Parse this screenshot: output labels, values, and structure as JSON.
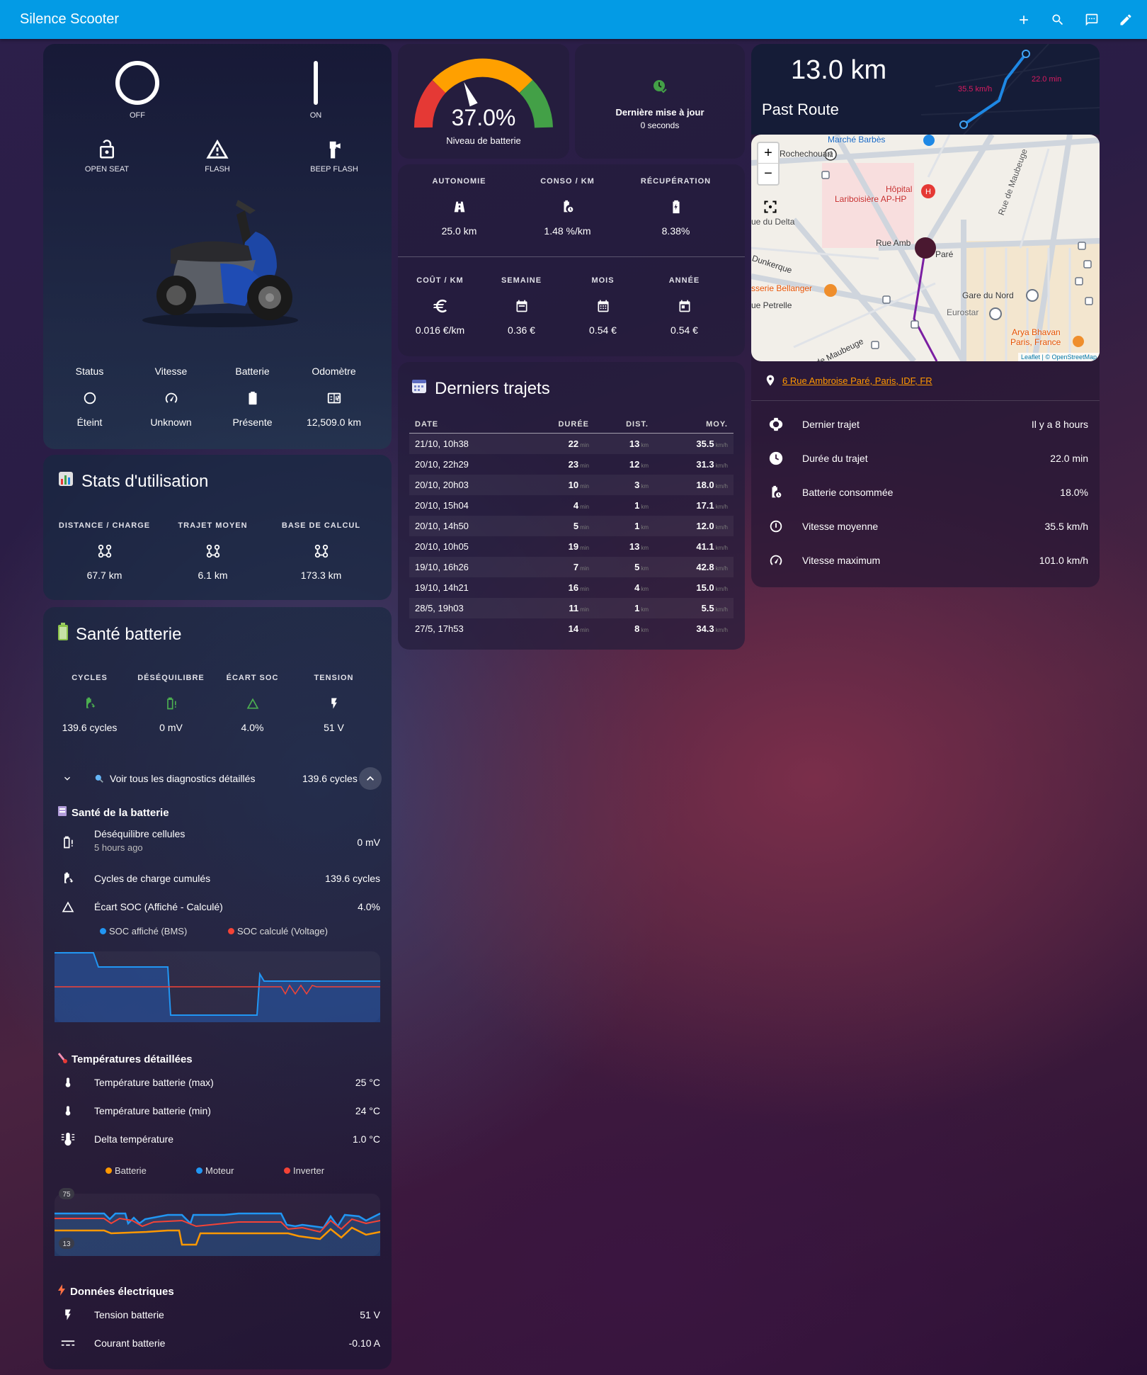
{
  "app": {
    "title": "Silence Scooter"
  },
  "controls": {
    "off": "OFF",
    "on": "ON",
    "open_seat": "OPEN SEAT",
    "flash": "FLASH",
    "beep_flash": "BEEP FLASH"
  },
  "scooter_stats": [
    {
      "label": "Status",
      "value": "Éteint",
      "icon": "power-off-icon"
    },
    {
      "label": "Vitesse",
      "value": "Unknown",
      "icon": "speedometer-icon"
    },
    {
      "label": "Batterie",
      "value": "Présente",
      "icon": "battery-icon"
    },
    {
      "label": "Odomètre",
      "value": "12,509.0 km",
      "icon": "counter-icon"
    }
  ],
  "gauge": {
    "value": "37.0%",
    "percent": 37,
    "label": "Niveau de batterie"
  },
  "update": {
    "title": "Dernière mise à jour",
    "value": "0 seconds"
  },
  "efficiency": {
    "top": [
      {
        "label": "AUTONOMIE",
        "value": "25.0 km"
      },
      {
        "label": "CONSO / KM",
        "value": "1.48 %/km"
      },
      {
        "label": "RÉCUPÉRATION",
        "value": "8.38%"
      }
    ],
    "bottom": [
      {
        "label": "COÛT / KM",
        "value": "0.016 €/km"
      },
      {
        "label": "SEMAINE",
        "value": "0.36 €"
      },
      {
        "label": "MOIS",
        "value": "0.54 €"
      },
      {
        "label": "ANNÉE",
        "value": "0.54 €"
      }
    ]
  },
  "route": {
    "distance": "13.0 km",
    "title": "Past Route",
    "speed_label": "35.5 km/h",
    "time_label": "22.0 min"
  },
  "map": {
    "labels": [
      "Marché Barbès",
      "Rochechouart",
      "Hôpital",
      "Lariboisière AP-HP",
      "ue du Delta",
      "Rue Amb",
      "Paré",
      "Dunkerque",
      "sserie Bellanger",
      "Gare du Nord",
      "Eurostar",
      "ue Petrelle",
      "de Maubeuge",
      "Rue de Maubeuge",
      "Arya Bhavan",
      "Paris, France"
    ],
    "attribution": "Leaflet | © OpenStreetMap",
    "zoom_in": "+",
    "zoom_out": "−"
  },
  "address": "6 Rue Ambroise Paré, Paris, IDF, FR",
  "trip_details": [
    {
      "label": "Dernier trajet",
      "value": "Il y a 8 hours"
    },
    {
      "label": "Durée du trajet",
      "value": "22.0 min"
    },
    {
      "label": "Batterie consommée",
      "value": "18.0%"
    },
    {
      "label": "Vitesse moyenne",
      "value": "35.5 km/h"
    },
    {
      "label": "Vitesse maximum",
      "value": "101.0 km/h"
    }
  ],
  "usage": {
    "title": "Stats d'utilisation",
    "items": [
      {
        "label": "DISTANCE / CHARGE",
        "value": "67.7 km"
      },
      {
        "label": "TRAJET MOYEN",
        "value": "6.1 km"
      },
      {
        "label": "BASE DE CALCUL",
        "value": "173.3 km"
      }
    ]
  },
  "trips": {
    "title": "Derniers trajets",
    "headers": [
      "DATE",
      "DURÉE",
      "DIST.",
      "MOY."
    ],
    "units": {
      "dur": "min",
      "dist": "km",
      "moy": "km/h"
    },
    "rows": [
      [
        "21/10, 10h38",
        "22",
        "13",
        "35.5"
      ],
      [
        "20/10, 22h29",
        "23",
        "12",
        "31.3"
      ],
      [
        "20/10, 20h03",
        "10",
        "3",
        "18.0"
      ],
      [
        "20/10, 15h04",
        "4",
        "1",
        "17.1"
      ],
      [
        "20/10, 14h50",
        "5",
        "1",
        "12.0"
      ],
      [
        "20/10, 10h05",
        "19",
        "13",
        "41.1"
      ],
      [
        "19/10, 16h26",
        "7",
        "5",
        "42.8"
      ],
      [
        "19/10, 14h21",
        "16",
        "4",
        "15.0"
      ],
      [
        "28/5, 19h03",
        "11",
        "1",
        "5.5"
      ],
      [
        "27/5, 17h53",
        "14",
        "8",
        "34.3"
      ]
    ]
  },
  "battery": {
    "title": "Santé batterie",
    "items": [
      {
        "label": "CYCLES",
        "value": "139.6 cycles"
      },
      {
        "label": "DÉSÉQUILIBRE",
        "value": "0 mV"
      },
      {
        "label": "ÉCART SOC",
        "value": "4.0%"
      },
      {
        "label": "TENSION",
        "value": "51 V"
      }
    ],
    "expander": {
      "label": "Voir tous les diagnostics détaillés",
      "value": "139.6 cycles"
    },
    "health_title": "Santé de la batterie",
    "health_rows": [
      {
        "label": "Déséquilibre cellules",
        "sub": "5 hours ago",
        "value": "0 mV"
      },
      {
        "label": "Cycles de charge cumulés",
        "value": "139.6 cycles"
      },
      {
        "label": "Écart SOC (Affiché - Calculé)",
        "value": "4.0%"
      }
    ],
    "soc_legend": [
      "SOC affiché (BMS)",
      "SOC calculé (Voltage)"
    ],
    "temp_title": "Températures détaillées",
    "temp_rows": [
      {
        "label": "Température batterie (max)",
        "value": "25 °C"
      },
      {
        "label": "Température batterie (min)",
        "value": "24 °C"
      },
      {
        "label": "Delta température",
        "value": "1.0 °C"
      }
    ],
    "temp_legend": [
      "Batterie",
      "Moteur",
      "Inverter"
    ],
    "temp_axis": {
      "max": "75",
      "min": "13"
    },
    "elec_title": "Données électriques",
    "elec_rows": [
      {
        "label": "Tension batterie",
        "value": "51 V"
      },
      {
        "label": "Courant batterie",
        "value": "-0.10 A"
      }
    ]
  },
  "colors": {
    "accent": "#039be5",
    "green": "#4caf50",
    "orange": "#ff9800",
    "red": "#f44336",
    "blue": "#2196f3"
  }
}
